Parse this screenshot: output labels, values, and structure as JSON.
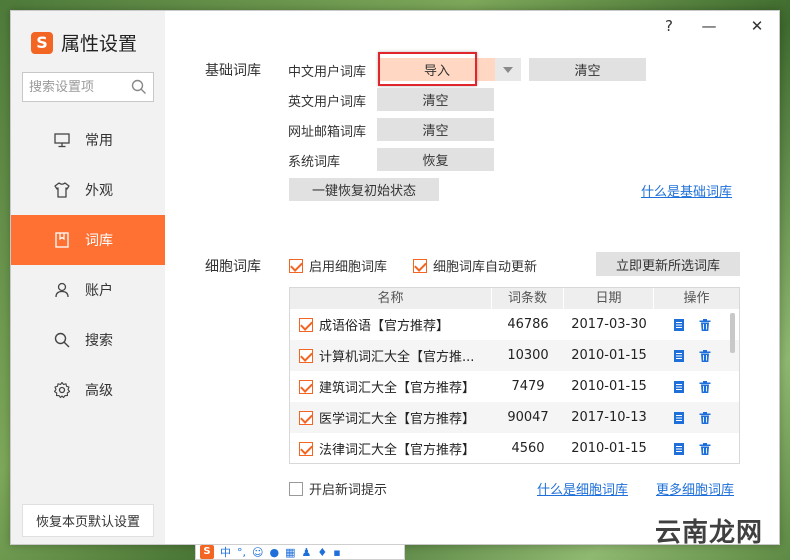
{
  "window": {
    "help_glyph": "?",
    "minimize_glyph": "—",
    "close_glyph": "✕"
  },
  "sidebar": {
    "brand_logo": "S",
    "brand_title": "属性设置",
    "search_placeholder": "搜索设置项",
    "items": [
      {
        "label": "常用",
        "icon": "monitor-icon"
      },
      {
        "label": "外观",
        "icon": "shirt-icon"
      },
      {
        "label": "词库",
        "icon": "dictionary-icon",
        "active": true
      },
      {
        "label": "账户",
        "icon": "user-icon"
      },
      {
        "label": "搜索",
        "icon": "search-icon"
      },
      {
        "label": "高级",
        "icon": "gear-icon"
      }
    ],
    "restore_default": "恢复本页默认设置"
  },
  "basic": {
    "section_title": "基础词库",
    "chinese_user_dict": "中文用户词库",
    "import_label": "导入",
    "clear_label": "清空",
    "english_user_dict": "英文用户词库",
    "url_email_dict": "网址邮箱词库",
    "system_dict": "系统词库",
    "restore_label": "恢复",
    "one_key_restore": "一键恢复初始状态",
    "what_is_basic_link": "什么是基础词库"
  },
  "cell": {
    "section_title": "细胞词库",
    "enable_label": "启用细胞词库",
    "enable_checked": true,
    "auto_update_label": "细胞词库自动更新",
    "auto_update_checked": true,
    "update_selected_button": "立即更新所选词库",
    "columns": [
      "名称",
      "词条数",
      "日期",
      "操作"
    ],
    "rows": [
      {
        "name": "成语俗语【官方推荐】",
        "count": "46786",
        "date": "2017-03-30",
        "checked": true
      },
      {
        "name": "计算机词汇大全【官方推...",
        "count": "10300",
        "date": "2010-01-15",
        "checked": true
      },
      {
        "name": "建筑词汇大全【官方推荐】",
        "count": "7479",
        "date": "2010-01-15",
        "checked": true
      },
      {
        "name": "医学词汇大全【官方推荐】",
        "count": "90047",
        "date": "2017-10-13",
        "checked": true
      },
      {
        "name": "法律词汇大全【官方推荐】",
        "count": "4560",
        "date": "2010-01-15",
        "checked": true
      }
    ],
    "new_word_tip_label": "开启新词提示",
    "new_word_tip_checked": false,
    "what_is_cell_link": "什么是细胞词库",
    "more_cell_link": "更多细胞词库"
  },
  "taskbar": {
    "logo": "S",
    "mode": "中"
  },
  "watermark": "云南龙网",
  "colors": {
    "accent": "#ff7033",
    "import_button": "#ffd7c2",
    "link": "#1e6fd9",
    "highlight": "#e0262c"
  }
}
